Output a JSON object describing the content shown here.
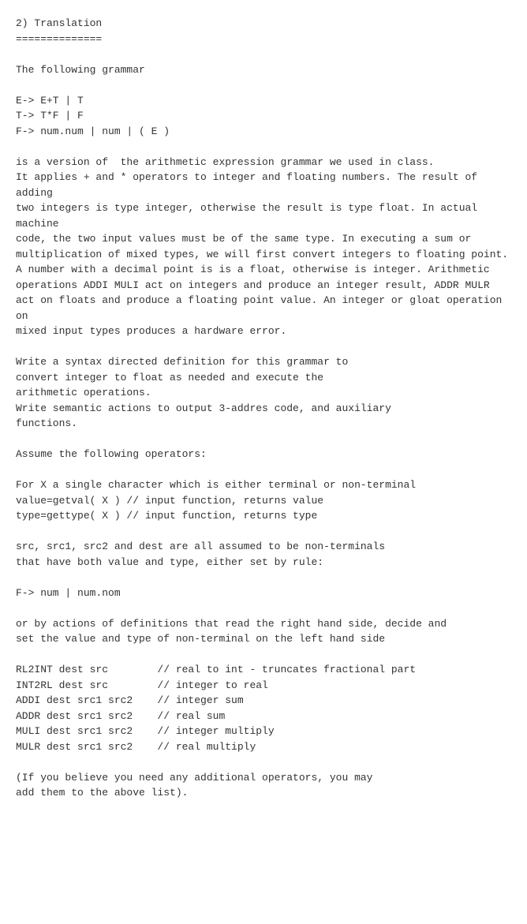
{
  "title": "2) Translation",
  "divider": "==============",
  "intro": "The following grammar",
  "grammar": [
    "E-> E+T | T",
    "T-> T*F | F",
    "F-> num.num | num | ( E )"
  ],
  "para1": "is a version of  the arithmetic expression grammar we used in class.\nIt applies + and * operators to integer and floating numbers. The result of adding\ntwo integers is type integer, otherwise the result is type float. In actual machine\ncode, the two input values must be of the same type. In executing a sum or\nmultiplication of mixed types, we will first convert integers to floating point.\nA number with a decimal point is is a float, otherwise is integer. Arithmetic\noperations ADDI MULI act on integers and produce an integer result, ADDR MULR\nact on floats and produce a floating point value. An integer or gloat operation on\nmixed input types produces a hardware error.",
  "task1": "Write a syntax directed definition for this grammar to\nconvert integer to float as needed and execute the\narithmetic operations.",
  "task2": "Write semantic actions to output 3-addres code, and auxiliary\nfunctions.",
  "opsHeading": "Assume the following operators:",
  "funcDesc": "For X a single character which is either terminal or non-terminal",
  "getval": "value=getval( X ) // input function, returns value",
  "gettype": "type=gettype( X ) // input function, returns type",
  "ntDesc": "src, src1, src2 and dest are all assumed to be non-terminals\nthat have both value and type, either set by rule:",
  "ruleF": "F-> num | num.nom",
  "actionsDesc": "or by actions of definitions that read the right hand side, decide and\nset the value and type of non-terminal on the left hand side",
  "ops": [
    "RL2INT dest src        // real to int - truncates fractional part",
    "INT2RL dest src        // integer to real",
    "ADDI dest src1 src2    // integer sum",
    "ADDR dest src1 src2    // real sum",
    "MULI dest src1 src2    // integer multiply",
    "MULR dest src1 src2    // real multiply"
  ],
  "closing": "(If you believe you need any additional operators, you may\nadd them to the above list)."
}
